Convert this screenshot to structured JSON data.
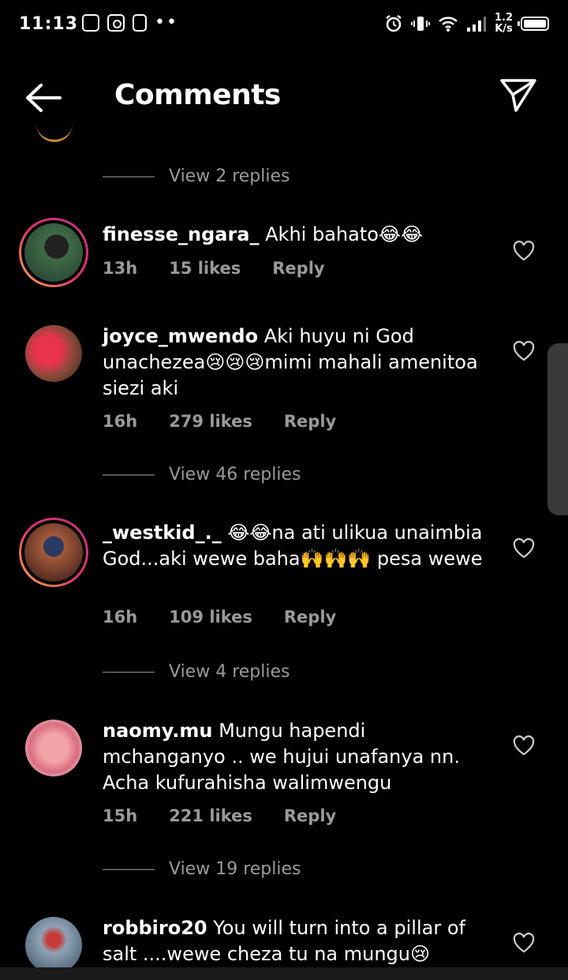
{
  "status_bar": {
    "time": "11:13",
    "dots": "••",
    "net_speed_value": "1.2",
    "net_speed_unit": "K/s"
  },
  "header": {
    "title": "Comments"
  },
  "comments": [
    {
      "view_replies_before": "View 2 replies"
    },
    {
      "username": "finesse_ngara_",
      "text": "Akhi bahato😂😂",
      "time": "13h",
      "likes": "15 likes",
      "reply": "Reply"
    },
    {
      "username": "joyce_mwendo",
      "text": "Aki huyu ni God unachezea😢😢😢mimi mahali amenitoa siezi aki",
      "time": "16h",
      "likes": "279 likes",
      "reply": "Reply",
      "view_replies": "View 46 replies"
    },
    {
      "username": "_westkid_._",
      "text": "😂😂na ati ulikua unaimbia God...aki wewe baha🙌🙌🙌 pesa wewe",
      "time": "16h",
      "likes": "109 likes",
      "reply": "Reply",
      "view_replies": "View 4 replies"
    },
    {
      "username": "naomy.mu",
      "text": "Mungu hapendi mchanganyo .. we hujui unafanya nn. Acha kufurahisha walimwengu",
      "time": "15h",
      "likes": "221 likes",
      "reply": "Reply",
      "view_replies": "View 19 replies"
    },
    {
      "username": "robbiro20",
      "text": "You will turn into a pillar of salt ....wewe cheza tu na mungu😢"
    }
  ],
  "colors": {
    "background": "#000000",
    "meta_text": "#9a9a9a",
    "story_ring_start": "#f9a94a",
    "story_ring_end": "#c13584"
  }
}
